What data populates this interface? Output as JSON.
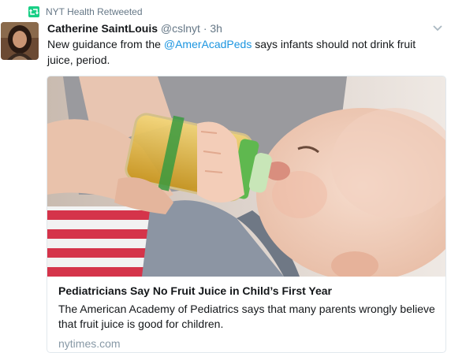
{
  "retweet": {
    "icon": "retweet-icon",
    "label": "NYT Health Retweeted"
  },
  "tweet": {
    "author_name": "Catherine SaintLouis",
    "handle": "@cslnyt",
    "separator": "·",
    "time": "3h",
    "text_before": "New guidance from the ",
    "mention": "@AmerAcadPeds",
    "text_after": " says infants should not drink fruit juice, period.",
    "mention_color": "#1b95e0"
  },
  "card": {
    "title": "Pediatricians Say No Fruit Juice in Child’s First Year",
    "description": "The American Academy of Pediatrics says that many parents wrongly believe that fruit juice is good for children.",
    "domain": "nytimes.com"
  },
  "colors": {
    "retweet_green": "#19cf86",
    "muted_text": "#657786",
    "border": "#e1e8ed"
  }
}
